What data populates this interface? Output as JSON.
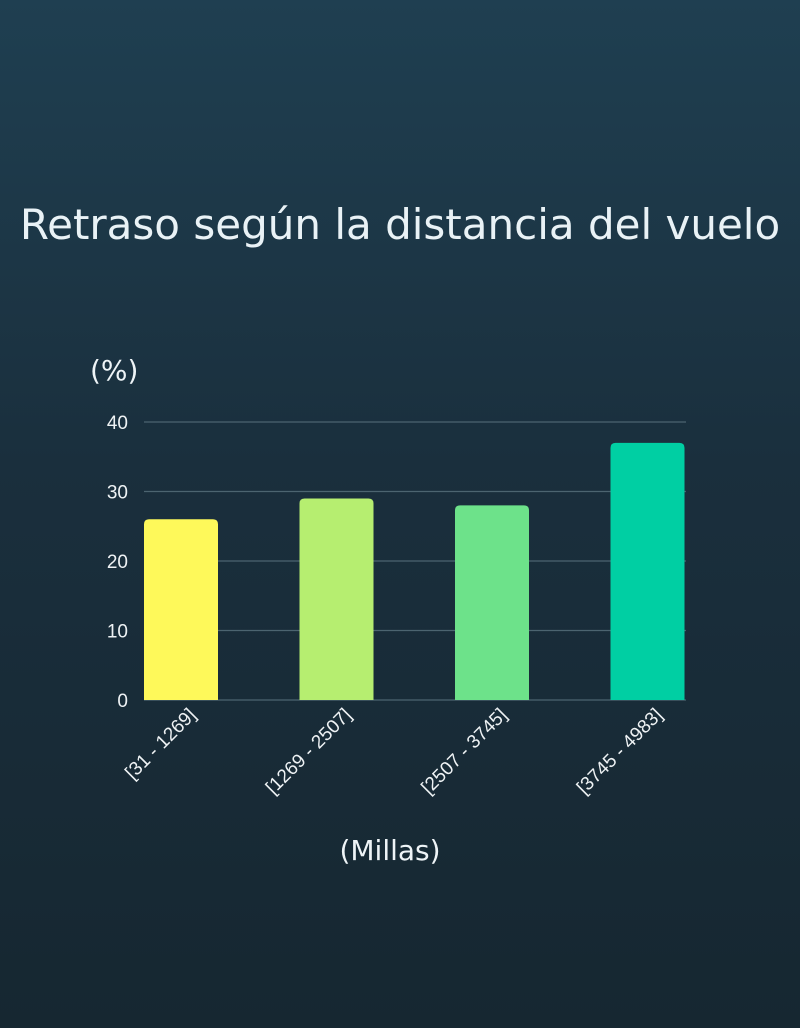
{
  "chart_data": {
    "type": "bar",
    "title": "Retraso según la distancia del vuelo",
    "ylabel": "(%)",
    "xlabel": "(Millas)",
    "categories": [
      "[31 - 1269]",
      "[1269 - 2507]",
      "[2507 - 3745]",
      "[3745 - 4983]"
    ],
    "values": [
      26,
      29,
      28,
      37
    ],
    "colors": [
      "#fef95a",
      "#b6ee70",
      "#6de28a",
      "#00cfa3"
    ],
    "ylim": [
      0,
      40
    ],
    "yticks": [
      0,
      10,
      20,
      30,
      40
    ],
    "grid": true,
    "gridColor": "#4c6470"
  }
}
